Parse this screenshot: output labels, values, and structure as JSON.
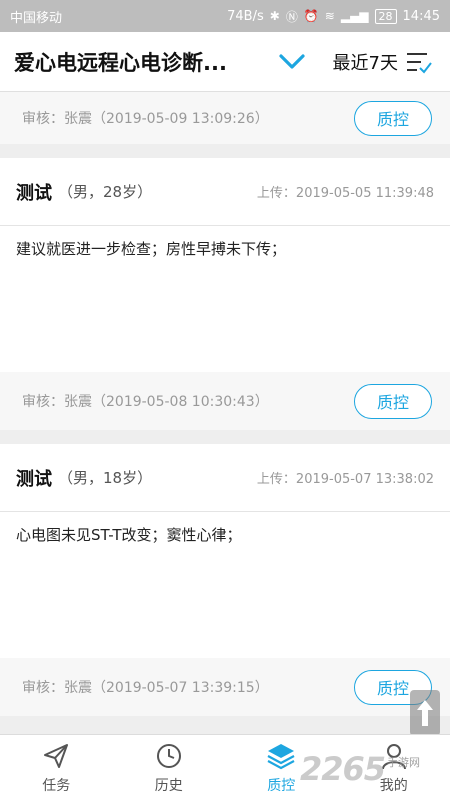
{
  "status_bar": {
    "carrier": "中国移动",
    "speed": "74B/s",
    "battery": "28",
    "time": "14:45"
  },
  "header": {
    "title": "爱心电远程心电诊断...",
    "range": "最近7天"
  },
  "list": {
    "partial": {
      "review": "审核：张震（2019-05-09 13:09:26）",
      "qc_label": "质控"
    },
    "cards": [
      {
        "name": "测试",
        "meta": "（男，28岁）",
        "upload": "上传：2019-05-05 11:39:48",
        "diagnosis": "建议就医进一步检查；房性早搏未下传；",
        "review": "审核：张震（2019-05-08 10:30:43）",
        "qc_label": "质控"
      },
      {
        "name": "测试",
        "meta": "（男，18岁）",
        "upload": "上传：2019-05-07 13:38:02",
        "diagnosis": "心电图未见ST-T改变；窦性心律；",
        "review": "审核：张震（2019-05-07 13:39:15）",
        "qc_label": "质控"
      }
    ]
  },
  "nav": {
    "items": [
      {
        "label": "任务",
        "icon": "send-icon"
      },
      {
        "label": "历史",
        "icon": "clock-icon"
      },
      {
        "label": "质控",
        "icon": "layers-icon"
      },
      {
        "label": "我的",
        "icon": "user-icon"
      }
    ]
  },
  "watermark": {
    "number": "2265",
    "text": "手游网"
  },
  "colors": {
    "accent": "#1da6e0",
    "header_bg": "#ffffff",
    "status_bg": "#bdbdbd"
  }
}
